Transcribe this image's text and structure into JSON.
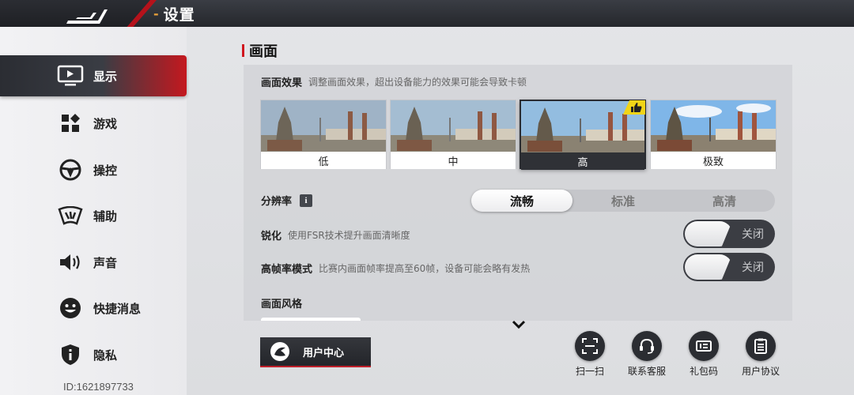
{
  "header": {
    "title": "设置"
  },
  "sidebar": {
    "items": [
      {
        "label": "显示",
        "icon": "monitor-icon",
        "active": true
      },
      {
        "label": "游戏",
        "icon": "grid-icon"
      },
      {
        "label": "操控",
        "icon": "steering-wheel-icon"
      },
      {
        "label": "辅助",
        "icon": "assist-icon"
      },
      {
        "label": "声音",
        "icon": "speaker-icon"
      },
      {
        "label": "快捷消息",
        "icon": "smiley-icon"
      },
      {
        "label": "隐私",
        "icon": "shield-icon"
      }
    ],
    "user_id": "ID:1621897733"
  },
  "main": {
    "section_title": "画面",
    "quality": {
      "label": "画面效果",
      "desc": "调整画面效果，超出设备能力的效果可能会导致卡顿",
      "options": [
        "低",
        "中",
        "高",
        "极致"
      ],
      "selected": "高"
    },
    "resolution": {
      "label": "分辨率",
      "info_icon": "i",
      "options": [
        "流畅",
        "标准",
        "高清"
      ],
      "selected": "流畅"
    },
    "sharpen": {
      "label": "锐化",
      "desc": "使用FSR技术提升画面清晰度",
      "state": "关闭"
    },
    "high_fps": {
      "label": "高帧率模式",
      "desc": "比赛内画面帧率提高至60帧，设备可能会略有发热",
      "state": "关闭"
    },
    "style": {
      "label": "画面风格"
    }
  },
  "bottom": {
    "user_center": "用户中心",
    "buttons": [
      {
        "label": "扫一扫",
        "icon": "scan-icon"
      },
      {
        "label": "联系客服",
        "icon": "headset-icon"
      },
      {
        "label": "礼包码",
        "icon": "gift-code-icon"
      },
      {
        "label": "用户协议",
        "icon": "clipboard-icon"
      }
    ]
  },
  "colors": {
    "accent": "#c4181f",
    "dark": "#2b2d32",
    "badge": "#f1d417"
  }
}
